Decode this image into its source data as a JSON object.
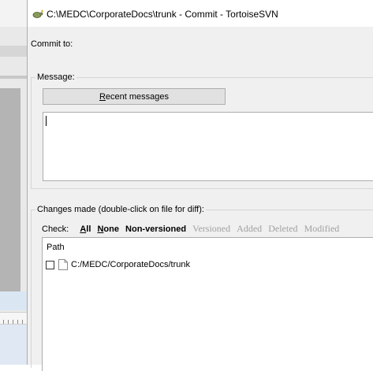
{
  "window": {
    "title": "C:\\MEDC\\CorporateDocs\\trunk - Commit - TortoiseSVN",
    "title_icon": "tortoisesvn-icon"
  },
  "commit_to": {
    "label": "Commit to:"
  },
  "message": {
    "group_label": "Message:",
    "recent_button": {
      "prefix": "",
      "accel": "R",
      "rest": "ecent messages"
    },
    "text": ""
  },
  "changes": {
    "group_label": "Changes made (double-click on file for diff):",
    "check_label": "Check:",
    "filters": [
      {
        "accel": "A",
        "rest": "ll",
        "enabled": true
      },
      {
        "accel": "N",
        "rest": "one",
        "enabled": true
      },
      {
        "accel": "",
        "rest": "Non-versioned",
        "enabled": true
      },
      {
        "accel": "",
        "rest": "Versioned",
        "enabled": false
      },
      {
        "accel": "",
        "rest": "Added",
        "enabled": false
      },
      {
        "accel": "",
        "rest": "Deleted",
        "enabled": false
      },
      {
        "accel": "",
        "rest": "Modified",
        "enabled": false
      }
    ],
    "columns": [
      "Path"
    ],
    "files": [
      {
        "path": "C:/MEDC/CorporateDocs/trunk",
        "checked": false,
        "icon": "file-icon"
      }
    ]
  }
}
